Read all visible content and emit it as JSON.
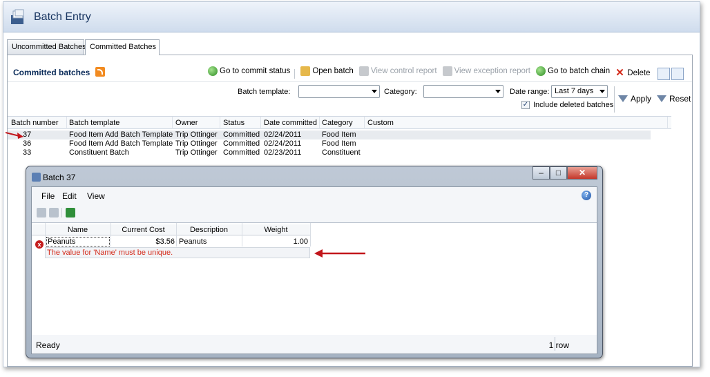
{
  "header": {
    "title": "Batch Entry",
    "icon": "batch-entry-icon"
  },
  "tabs": [
    {
      "label": "Uncommitted Batches"
    },
    {
      "label": "Committed Batches"
    }
  ],
  "panel": {
    "title": "Committed batches",
    "toolbar": {
      "commit_status": "Go to commit status",
      "open_batch": "Open batch",
      "control_report": "View control report",
      "exception_report": "View exception report",
      "batch_chain": "Go to batch chain",
      "delete": "Delete"
    },
    "filters": {
      "batch_template_label": "Batch template:",
      "batch_template_value": "",
      "category_label": "Category:",
      "category_value": "",
      "date_range_label": "Date range:",
      "date_range_value": "Last 7 days",
      "include_deleted": "Include deleted batches",
      "apply": "Apply",
      "reset": "Reset"
    },
    "grid": {
      "columns": [
        "Batch number",
        "Batch template",
        "Owner",
        "Status",
        "Date committed",
        "Category",
        "Custom"
      ],
      "rows": [
        [
          "37",
          "Food Item Add Batch Template",
          "Trip Ottinger",
          "Committed",
          "02/24/2011",
          "Food Item",
          ""
        ],
        [
          "36",
          "Food Item Add Batch Template",
          "Trip Ottinger",
          "Committed",
          "02/24/2011",
          "Food Item",
          ""
        ],
        [
          "33",
          "Constituent Batch",
          "Trip Ottinger",
          "Committed",
          "02/23/2011",
          "Constituent",
          ""
        ]
      ]
    }
  },
  "dialog": {
    "title": "Batch 37",
    "menu": {
      "file": "File",
      "edit": "Edit",
      "view": "View",
      "help": "?"
    },
    "grid": {
      "columns": [
        "Name",
        "Current Cost",
        "Description",
        "Weight"
      ],
      "row": [
        "Peanuts",
        "$3.56",
        "Peanuts",
        "1.00"
      ],
      "error": "The value for 'Name' must be unique.",
      "error_icon": "x"
    },
    "status": "Ready",
    "rowcount": "1 row"
  },
  "colors": {
    "accent": "#15325e",
    "error": "#d42a1a",
    "arrow": "#c2161b"
  }
}
